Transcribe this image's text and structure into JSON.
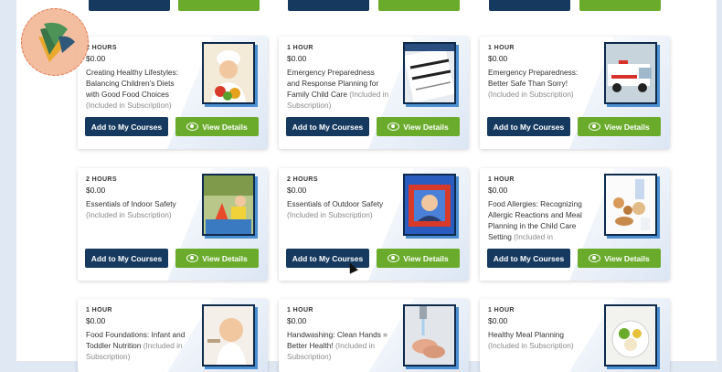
{
  "labels": {
    "add_button": "Add to My Courses",
    "view_button": "View Details",
    "subscription_note": "(Included in Subscription)",
    "subscription_note_partial": "(Included in"
  },
  "courses": [
    {
      "hours": "2 HOURS",
      "price": "$0.00",
      "title": "Creating Healthy Lifestyles: Balancing Children's Diets with Good Food Choices",
      "image": "child-chef-photo"
    },
    {
      "hours": "1 HOUR",
      "price": "$0.00",
      "title": "Emergency Preparedness and Response Planning for Family Child Care",
      "image": "emergency-checklist-photo"
    },
    {
      "hours": "1 HOUR",
      "price": "$0.00",
      "title": "Emergency Preparedness: Better Safe Than Sorry!",
      "image": "ambulance-photo"
    },
    {
      "hours": "2 HOURS",
      "price": "$0.00",
      "title": "Essentials of Indoor Safety",
      "image": "indoor-play-photo"
    },
    {
      "hours": "2 HOURS",
      "price": "$0.00",
      "title": "Essentials of Outdoor Safety",
      "image": "outdoor-play-photo"
    },
    {
      "hours": "1 HOUR",
      "price": "$0.00",
      "title": "Food Allergies: Recognizing Allergic Reactions and Meal Planning in the Child Care Setting",
      "image": "allergy-foods-photo"
    },
    {
      "hours": "1 HOUR",
      "price": "$0.00",
      "title": "Food Foundations: Infant and Toddler Nutrition",
      "image": "infant-eating-photo"
    },
    {
      "hours": "1 HOUR",
      "price": "$0.00",
      "title": "Handwashing: Clean Hands = Better Health!",
      "image": "handwashing-photo"
    },
    {
      "hours": "1 HOUR",
      "price": "$0.00",
      "title": "Healthy Meal Planning",
      "image": "healthy-meal-photo"
    }
  ],
  "colors": {
    "add_button": "#163a5f",
    "view_button": "#6aab2c",
    "logo_circle": "#f2b898",
    "background": "#dfe8f3"
  }
}
